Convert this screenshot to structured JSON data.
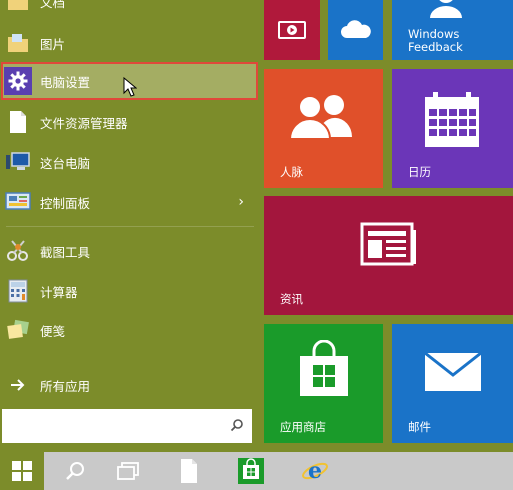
{
  "menu": {
    "items": [
      {
        "label": "文档",
        "icon": "documents-folder-icon"
      },
      {
        "label": "图片",
        "icon": "pictures-folder-icon"
      },
      {
        "label": "电脑设置",
        "icon": "gear-icon"
      },
      {
        "label": "文件资源管理器",
        "icon": "file-explorer-icon"
      },
      {
        "label": "这台电脑",
        "icon": "this-pc-icon"
      },
      {
        "label": "控制面板",
        "icon": "control-panel-icon"
      },
      {
        "label": "截图工具",
        "icon": "snipping-tool-icon"
      },
      {
        "label": "计算器",
        "icon": "calculator-icon"
      },
      {
        "label": "便笺",
        "icon": "sticky-notes-icon"
      },
      {
        "label": "所有应用",
        "icon": "arrow-right-icon"
      }
    ],
    "selected_label": "电脑设置"
  },
  "tiles": {
    "feedback": "Windows\nFeedback",
    "people": "人脉",
    "calendar": "日历",
    "news": "资讯",
    "store": "应用商店",
    "mail": "邮件"
  },
  "taskbar": {
    "icons": [
      "windows-start-icon",
      "search-icon",
      "task-view-icon",
      "document-icon",
      "store-icon",
      "internet-explorer-icon"
    ]
  },
  "colors": {
    "start_bg": "#7c8c2a",
    "selected_bg": "#a4ad63",
    "selected_border": "#e0483a",
    "taskbar_bg": "#c9c9c9"
  }
}
